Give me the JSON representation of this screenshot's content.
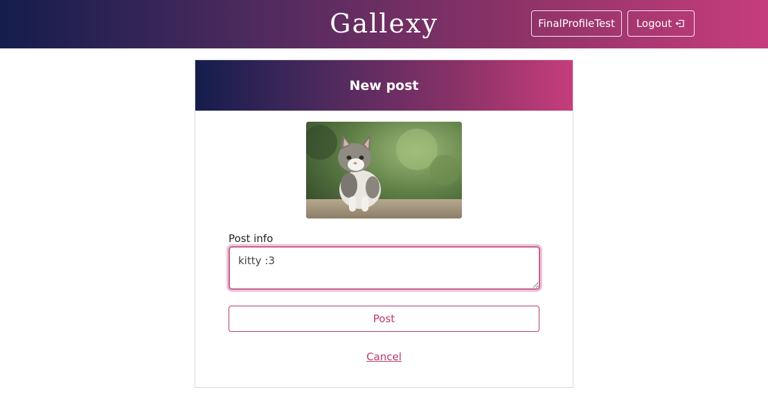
{
  "navbar": {
    "brand": "Gallexy",
    "profile_label": "FinalProfileTest",
    "logout_label": "Logout",
    "logout_icon": "logout-icon"
  },
  "card": {
    "title": "New post",
    "image_subject": "kitten",
    "field_label": "Post info",
    "post_info_value": "kitty :3",
    "post_button": "Post",
    "cancel_link": "Cancel"
  },
  "colors": {
    "gradient_start": "#141d4c",
    "gradient_end": "#c63d7c",
    "accent": "#b8386e",
    "focus_border": "#c95f93"
  }
}
